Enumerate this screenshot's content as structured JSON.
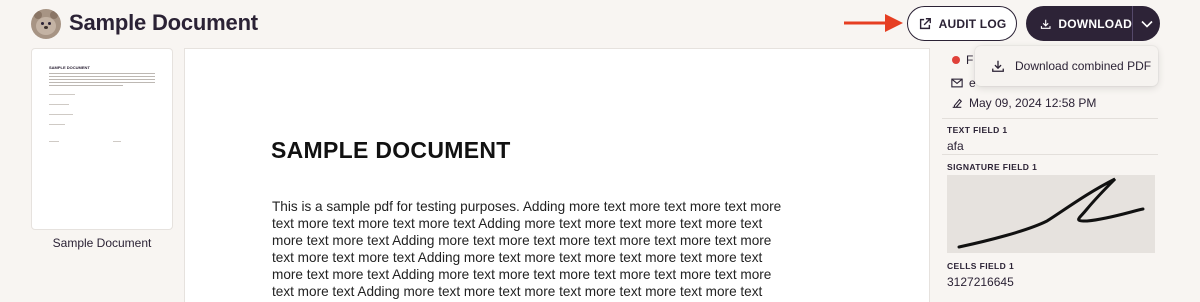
{
  "header": {
    "title": "Sample Document",
    "audit_label": "AUDIT LOG",
    "download_label": "DOWNLOAD"
  },
  "dropdown": {
    "items": [
      {
        "label": "Download combined PDF",
        "icon": "download-icon"
      }
    ]
  },
  "thumbnail": {
    "title": "SAMPLE DOCUMENT",
    "caption": "Sample Document"
  },
  "viewer": {
    "title": "SAMPLE DOCUMENT",
    "lines": [
      "This is a sample pdf for testing purposes. Adding more text more text more text more",
      "text more text more text more text Adding more text more text more text more text",
      "more text more text Adding more text more text more text more text more text more",
      "text more text more text Adding more text more text more text more text more text",
      "more text more text Adding more text more text more text more text more text more",
      "text more text Adding more text more text more text more text more text more text"
    ]
  },
  "side": {
    "status_text": "F",
    "email_text": "e",
    "timestamp": "May 09, 2024 12:58 PM",
    "fields": [
      {
        "label": "TEXT FIELD 1",
        "value": "afa"
      },
      {
        "label": "SIGNATURE FIELD 1",
        "value": ""
      },
      {
        "label": "CELLS FIELD 1",
        "value": "3127216645"
      }
    ]
  },
  "colors": {
    "accent": "#2d2337",
    "status_red": "#e0413a",
    "annotation_arrow": "#e63e22",
    "background": "#f8f5f2"
  }
}
